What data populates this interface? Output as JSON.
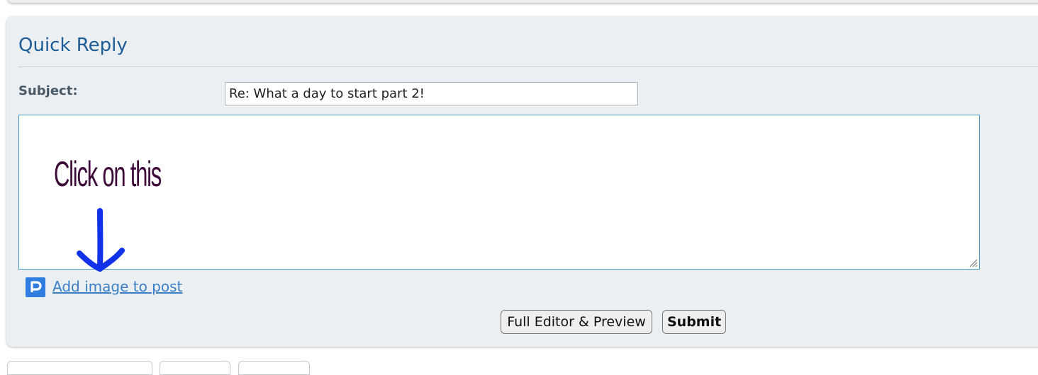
{
  "quick_reply": {
    "title": "Quick Reply",
    "subject_label": "Subject:",
    "subject_value": "Re: What a day to start part 2!",
    "message_value": "",
    "annotation_text": "Click on this",
    "add_image_label": "Add image to post",
    "add_image_icon": "photobucket-icon",
    "full_editor_label": "Full Editor & Preview",
    "submit_label": "Submit"
  },
  "colors": {
    "title": "#1d5c95",
    "link": "#3a7fc6",
    "panel_background": "#ebeff2",
    "annotation_text": "#3d0a3a",
    "annotation_arrow": "#1132e8"
  }
}
